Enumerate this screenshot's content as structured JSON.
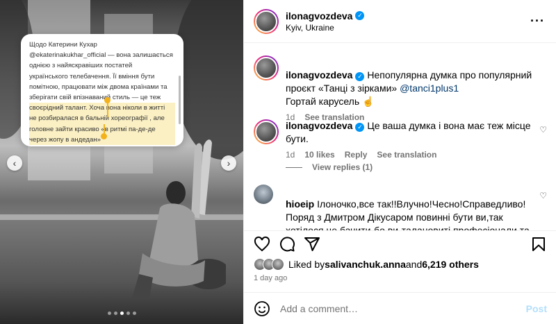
{
  "media": {
    "quote_lines": {
      "intro": "Щодо Катерини Кухар\n@ekaterinakukhar_official — вона залишається\nоднією з найяскравіших постатей\nукраїнського телебачення. Її вміння бути\nпомітною, працювати між двома країнами та\nзберігати свій впізнаваний стиль — це теж",
      "highlight": "своєрідний талант. Хоча вона ніколи в житті\nне розбиралася в бальній хореографії , але\nголовне зайти красиво «в ритмі па-де-де\nчерез жопу в андедан»"
    },
    "prev_icon": "chevron-left-icon",
    "next_icon": "chevron-right-icon",
    "slides_count": 5,
    "active_slide": 2
  },
  "header": {
    "username": "ilonagvozdeva",
    "location": "Kyiv, Ukraine",
    "more_icon": "more-icon"
  },
  "comments": {
    "caption": {
      "username": "ilonagvozdeva",
      "text_before": " Непопулярна думка про популярний проєкт «Танці з зірками» ",
      "mention": "@tanci1plus1",
      "text_after": "\nГортай карусель ☝️",
      "time": "1d",
      "see_translation": "See translation"
    },
    "owner_comment": {
      "username": "ilonagvozdeva",
      "text": " Це ваша думка і вона має теж місце бути.",
      "time": "1d",
      "likes": "10 likes",
      "reply": "Reply",
      "see_translation": "See translation"
    },
    "view_replies": "View replies (1)",
    "user_comment": {
      "username": "hioeip",
      "text": " Ілоночко,все так!!Влучно!Чесно!Справедливо!\nПоряд з Дмитром Дікусаром повинні бути ви,так хотілося це бачити-бо ви-талановиті професіонали та щиро - справедливі!!"
    }
  },
  "actions": {
    "like_icon": "heart-icon",
    "comment_icon": "comment-icon",
    "share_icon": "share-icon",
    "save_icon": "bookmark-icon"
  },
  "likes": {
    "prefix": "Liked by ",
    "user": "salivanchuk.anna",
    "middle": " and ",
    "others": "6,219 others"
  },
  "time_ago": "1 day ago",
  "add_comment": {
    "placeholder": "Add a comment…",
    "post_label": "Post",
    "emoji_icon": "emoji-icon"
  },
  "colors": {
    "verified": "#0095f6",
    "link": "#00376b",
    "highlight": "#fbf0c4",
    "marker": "#f3b21b",
    "post_disabled": "#b2dffc"
  }
}
